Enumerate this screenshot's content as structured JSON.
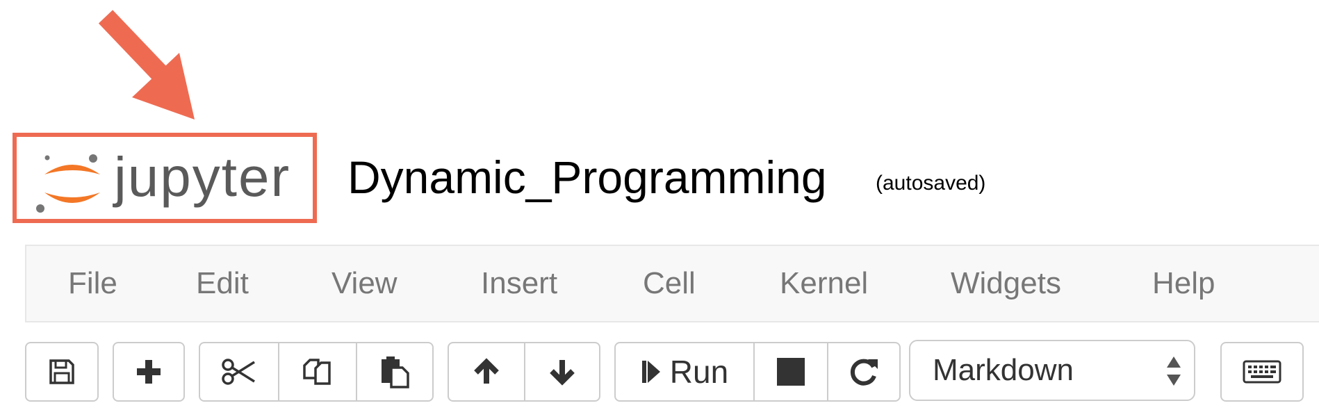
{
  "logo": {
    "text": "jupyter",
    "colors": {
      "orange": "#f37726",
      "gray": "#767677",
      "highlight_box": "#ee6b52",
      "arrow": "#ee6b52"
    }
  },
  "notebook": {
    "title": "Dynamic_Programming",
    "status": "(autosaved)"
  },
  "menu": {
    "items": [
      {
        "label": "File"
      },
      {
        "label": "Edit"
      },
      {
        "label": "View"
      },
      {
        "label": "Insert"
      },
      {
        "label": "Cell"
      },
      {
        "label": "Kernel"
      },
      {
        "label": "Widgets"
      },
      {
        "label": "Help"
      }
    ]
  },
  "toolbar": {
    "run_label": "Run",
    "cell_type": "Markdown",
    "icons": [
      "save-icon",
      "plus-icon",
      "scissors-icon",
      "copy-icon",
      "paste-icon",
      "arrow-up-icon",
      "arrow-down-icon",
      "step-forward-icon",
      "stop-icon",
      "refresh-icon",
      "sort-caret-icon",
      "keyboard-icon"
    ]
  }
}
